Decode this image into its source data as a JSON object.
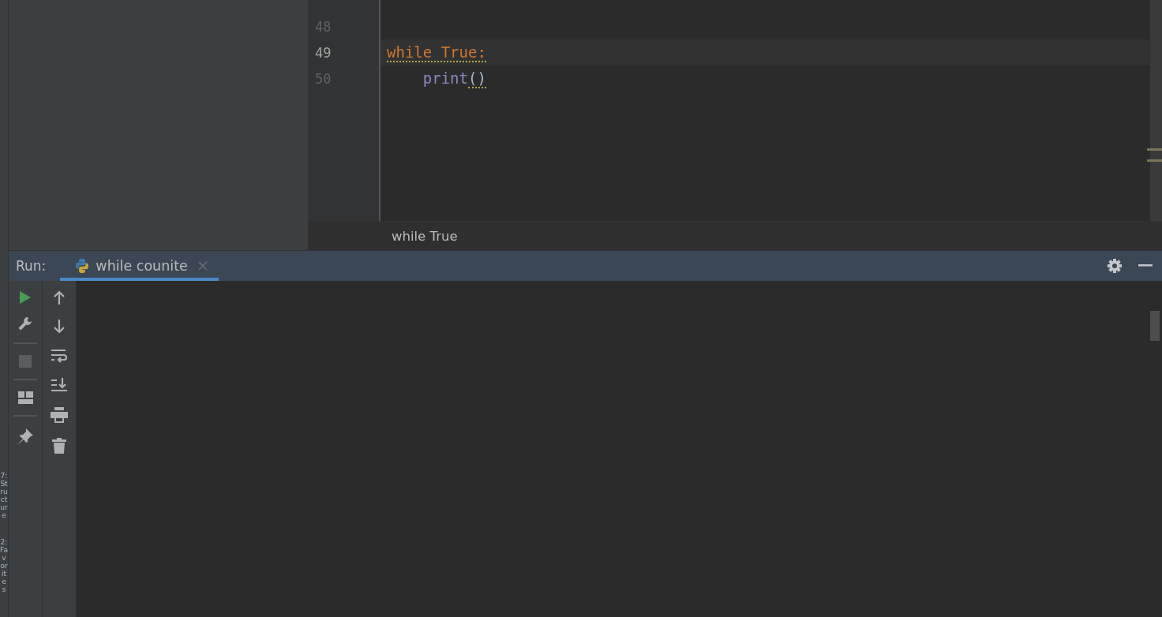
{
  "side_tabs": [
    "7: Structure",
    "2: Favorites"
  ],
  "editor": {
    "lines": [
      {
        "number": "48",
        "current": false
      },
      {
        "number": "49",
        "current": true,
        "tokens": [
          {
            "text": "while True:",
            "kind": "keyword",
            "warning": true
          }
        ]
      },
      {
        "number": "50",
        "current": false,
        "tokens": [
          {
            "text": "    print",
            "kind": "builtin",
            "warning": false
          },
          {
            "text": "()",
            "kind": "plain",
            "warning": true
          }
        ]
      }
    ],
    "breadcrumb": "while True"
  },
  "run_panel": {
    "label": "Run:",
    "tabs": [
      {
        "label": "while counite",
        "selected": true
      }
    ]
  }
}
